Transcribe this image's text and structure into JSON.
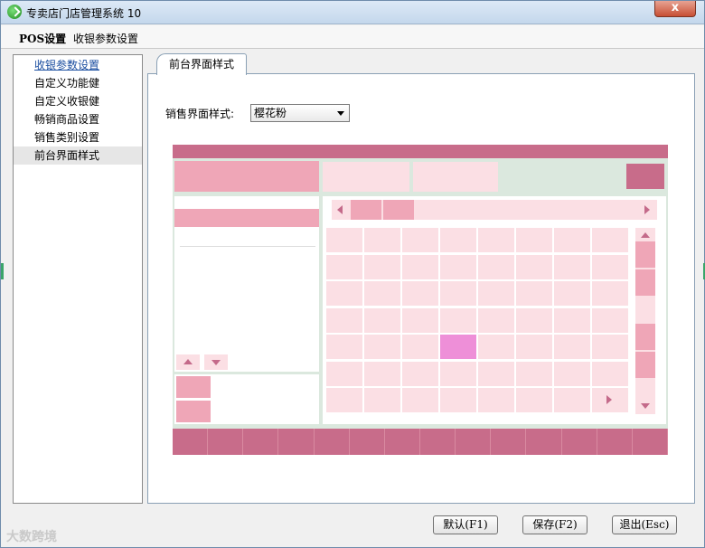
{
  "window": {
    "title": "专卖店门店管理系统 10",
    "close_label": "x"
  },
  "menu": {
    "pos_label": "POS设置",
    "cash_label": "收银参数设置"
  },
  "sidebar": {
    "items": [
      {
        "label": "收银参数设置"
      },
      {
        "label": "自定义功能健"
      },
      {
        "label": "自定义收银健"
      },
      {
        "label": "畅销商品设置"
      },
      {
        "label": "销售类别设置"
      },
      {
        "label": "前台界面样式"
      }
    ]
  },
  "tab": {
    "label": "前台界面样式"
  },
  "style_field": {
    "label": "销售界面样式:",
    "value": "樱花粉"
  },
  "colors": {
    "dark_pink": "#c86c8a",
    "mid_pink": "#efa6b7",
    "light_pink": "#fbdfe4",
    "highlight": "#ee8fd8",
    "panel_bg": "#dbe8de"
  },
  "buttons": {
    "default_label": "默认(F1)",
    "save_label": "保存(F2)",
    "exit_label": "退出(Esc)"
  },
  "watermark": {
    "text": "大数跨境"
  }
}
